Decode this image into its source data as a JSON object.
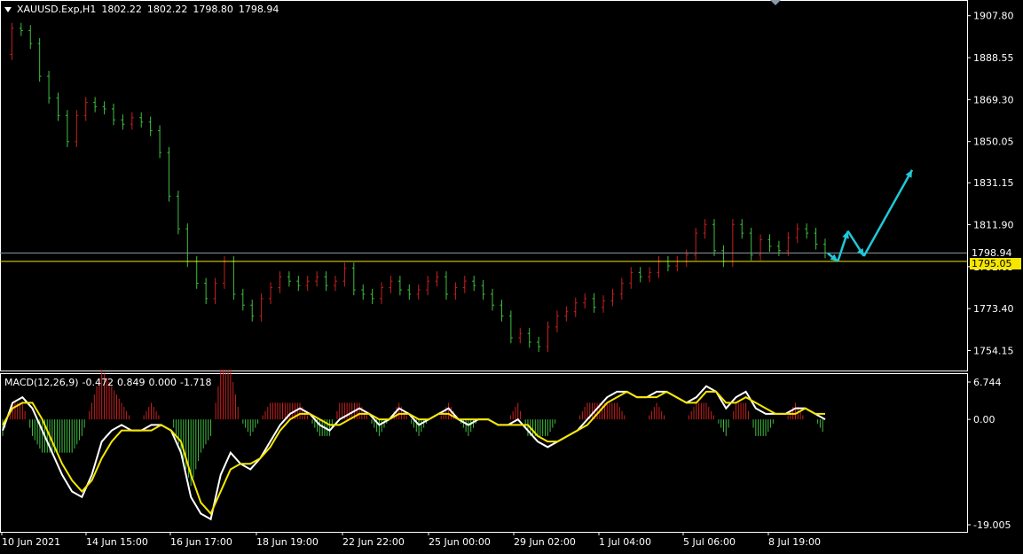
{
  "header": {
    "symbol": "XAUUSD.Exp,H1",
    "open": "1802.22",
    "high": "1802.22",
    "low": "1798.80",
    "close": "1798.94"
  },
  "macd_header": {
    "label": "MACD(12,26,9)",
    "main": "-0.472",
    "signal": "0.849",
    "v3": "0.000",
    "v4": "-1.718"
  },
  "price_tags": {
    "bid": "1798.94",
    "line": "1795.05"
  },
  "colors": {
    "background": "#000000",
    "bull": "#c8201e",
    "bear": "#3fbf3f",
    "macd_main": "#ffffff",
    "macd_signal": "#f5e600",
    "arrows": "#20c8d8",
    "level_line": "#f5e600",
    "bid_line": "#8a9aa8"
  },
  "chart_data": [
    {
      "type": "line",
      "title": "",
      "ylim": [
        1745,
        1915
      ],
      "y_ticks": [
        "1907.80",
        "1888.55",
        "1869.30",
        "1850.05",
        "1831.15",
        "1811.90",
        "1792.65",
        "1773.40",
        "1754.15"
      ],
      "x_ticks": [
        "10 Jun 2021",
        "14 Jun 15:00",
        "16 Jun 17:00",
        "18 Jun 19:00",
        "22 Jun 22:00",
        "25 Jun 00:00",
        "29 Jun 02:00",
        "1 Jul 04:00",
        "5 Jul 06:00",
        "8 Jul 19:00"
      ],
      "levels": [
        {
          "name": "",
          "value": 1795.05
        },
        {
          "name": "",
          "value": 1798.94
        }
      ],
      "path": [
        [
          0,
          1890
        ],
        [
          6,
          1902
        ],
        [
          12,
          1901
        ],
        [
          18,
          1895
        ],
        [
          24,
          1880
        ],
        [
          30,
          1870
        ],
        [
          36,
          1862
        ],
        [
          42,
          1850
        ],
        [
          48,
          1862
        ],
        [
          54,
          1868
        ],
        [
          60,
          1866
        ],
        [
          66,
          1865
        ],
        [
          72,
          1860
        ],
        [
          78,
          1858
        ],
        [
          84,
          1861
        ],
        [
          90,
          1859
        ],
        [
          96,
          1855
        ],
        [
          102,
          1845
        ],
        [
          106,
          1825
        ],
        [
          112,
          1810
        ],
        [
          118,
          1795
        ],
        [
          122,
          1785
        ],
        [
          128,
          1778
        ],
        [
          134,
          1785
        ],
        [
          140,
          1795
        ],
        [
          144,
          1780
        ],
        [
          150,
          1775
        ],
        [
          156,
          1770
        ],
        [
          162,
          1778
        ],
        [
          168,
          1783
        ],
        [
          174,
          1788
        ],
        [
          180,
          1786
        ],
        [
          186,
          1784
        ],
        [
          192,
          1786
        ],
        [
          198,
          1788
        ],
        [
          204,
          1784
        ],
        [
          210,
          1786
        ],
        [
          216,
          1792
        ],
        [
          222,
          1782
        ],
        [
          228,
          1780
        ],
        [
          234,
          1778
        ],
        [
          240,
          1783
        ],
        [
          246,
          1786
        ],
        [
          252,
          1782
        ],
        [
          258,
          1780
        ],
        [
          264,
          1782
        ],
        [
          270,
          1786
        ],
        [
          276,
          1788
        ],
        [
          282,
          1780
        ],
        [
          288,
          1783
        ],
        [
          294,
          1786
        ],
        [
          300,
          1784
        ],
        [
          306,
          1780
        ],
        [
          312,
          1775
        ],
        [
          318,
          1770
        ],
        [
          324,
          1760
        ],
        [
          330,
          1762
        ],
        [
          336,
          1758
        ],
        [
          342,
          1756
        ],
        [
          348,
          1765
        ],
        [
          354,
          1770
        ],
        [
          360,
          1772
        ],
        [
          366,
          1776
        ],
        [
          372,
          1778
        ],
        [
          378,
          1774
        ],
        [
          384,
          1777
        ],
        [
          390,
          1780
        ],
        [
          396,
          1785
        ],
        [
          402,
          1790
        ],
        [
          408,
          1788
        ],
        [
          414,
          1790
        ],
        [
          420,
          1795
        ],
        [
          426,
          1793
        ],
        [
          432,
          1795
        ],
        [
          438,
          1798
        ],
        [
          444,
          1808
        ],
        [
          450,
          1812
        ],
        [
          456,
          1800
        ],
        [
          462,
          1795
        ],
        [
          468,
          1812
        ],
        [
          474,
          1808
        ],
        [
          480,
          1798
        ],
        [
          486,
          1805
        ],
        [
          492,
          1802
        ],
        [
          498,
          1800
        ],
        [
          504,
          1806
        ],
        [
          510,
          1810
        ],
        [
          516,
          1808
        ],
        [
          522,
          1803
        ],
        [
          528,
          1799
        ]
      ],
      "arrows": [
        {
          "from": [
            1800.5,
            1798.8
          ],
          "to": [
            1803.0,
            1795.1
          ]
        },
        {
          "from": [
            1803.0,
            1795.1
          ],
          "to": [
            1805.5,
            1809.0
          ]
        },
        {
          "from": [
            1805.5,
            1809.0
          ],
          "to": [
            1809.5,
            1797.5
          ]
        },
        {
          "from": [
            1809.5,
            1797.5
          ],
          "to": [
            1821.5,
            1837.0
          ]
        }
      ]
    },
    {
      "type": "bar",
      "title": "MACD(12,26,9)",
      "ylim": [
        -19.005,
        6.744
      ],
      "y_ticks": [
        "6.744",
        "0.00",
        "-19.005"
      ],
      "series": [
        {
          "name": "",
          "kind": "line",
          "values": [
            -2,
            3,
            4,
            2,
            -2,
            -6,
            -10,
            -13,
            -14,
            -10,
            -4,
            -2,
            -1,
            -2,
            -2,
            -1,
            -1,
            -2,
            -6,
            -14,
            -17,
            -18,
            -10,
            -6,
            -8,
            -9,
            -7,
            -4,
            -1,
            1,
            2,
            1,
            -1,
            -2,
            0,
            1,
            2,
            1,
            -1,
            0,
            2,
            1,
            -1,
            0,
            1,
            2,
            0,
            -1,
            0,
            0,
            -1,
            -1,
            0,
            -2,
            -4,
            -5,
            -4,
            -3,
            -2,
            0,
            2,
            4,
            5,
            5,
            4,
            4,
            5,
            5,
            4,
            3,
            4,
            6,
            5,
            2,
            4,
            5,
            2,
            1,
            1,
            1,
            2,
            2,
            1,
            0
          ]
        },
        {
          "name": "",
          "kind": "signal",
          "values": [
            -1,
            2,
            3,
            3,
            0,
            -4,
            -8,
            -11,
            -13,
            -11,
            -7,
            -4,
            -2,
            -2,
            -2,
            -2,
            -1,
            -2,
            -4,
            -10,
            -15,
            -17,
            -13,
            -9,
            -8,
            -8,
            -7,
            -5,
            -2,
            0,
            1,
            1,
            0,
            -1,
            -1,
            0,
            1,
            1,
            0,
            0,
            1,
            1,
            0,
            0,
            1,
            1,
            0,
            0,
            0,
            0,
            -1,
            -1,
            -1,
            -1,
            -3,
            -4,
            -4,
            -3,
            -2,
            -1,
            1,
            3,
            4,
            5,
            4,
            4,
            4,
            5,
            4,
            3,
            3,
            5,
            5,
            3,
            3,
            4,
            3,
            2,
            1,
            1,
            1,
            2,
            1,
            1
          ]
        }
      ]
    }
  ]
}
